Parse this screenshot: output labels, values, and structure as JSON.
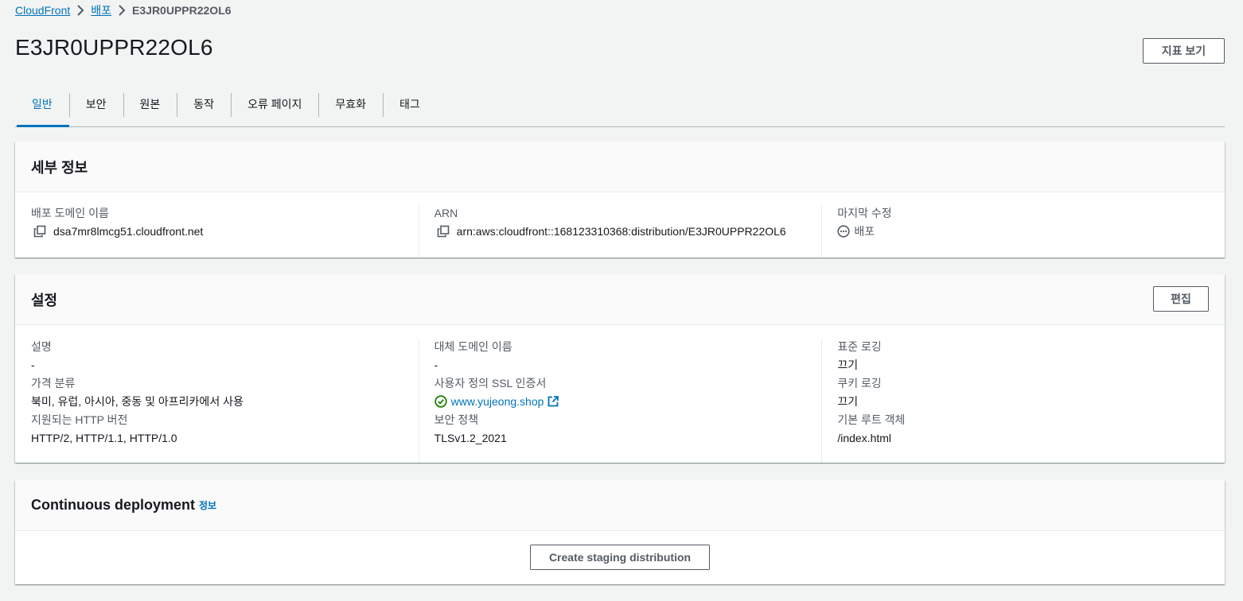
{
  "breadcrumb": {
    "items": [
      "CloudFront",
      "배포"
    ],
    "current": "E3JR0UPPR22OL6"
  },
  "page": {
    "title": "E3JR0UPPR22OL6",
    "metrics_button": "지표 보기"
  },
  "tabs": [
    {
      "label": "일반",
      "active": true
    },
    {
      "label": "보안",
      "active": false
    },
    {
      "label": "원본",
      "active": false
    },
    {
      "label": "동작",
      "active": false
    },
    {
      "label": "오류 페이지",
      "active": false
    },
    {
      "label": "무효화",
      "active": false
    },
    {
      "label": "태그",
      "active": false
    }
  ],
  "details": {
    "title": "세부 정보",
    "domain_label": "배포 도메인 이름",
    "domain_value": "dsa7mr8lmcg51.cloudfront.net",
    "arn_label": "ARN",
    "arn_value": "arn:aws:cloudfront::168123310368:distribution/E3JR0UPPR22OL6",
    "modified_label": "마지막 수정",
    "modified_value": "배포"
  },
  "settings": {
    "title": "설정",
    "edit_button": "편집",
    "description_label": "설명",
    "description_value": "-",
    "price_class_label": "가격 분류",
    "price_class_value": "북미, 유럽, 아시아, 중동 및 아프리카에서 사용",
    "http_label": "지원되는 HTTP 버전",
    "http_value": "HTTP/2, HTTP/1.1, HTTP/1.0",
    "alt_domain_label": "대체 도메인 이름",
    "alt_domain_value": "-",
    "ssl_label": "사용자 정의 SSL 인증서",
    "ssl_value": "www.yujeong.shop",
    "security_policy_label": "보안 정책",
    "security_policy_value": "TLSv1.2_2021",
    "std_logging_label": "표준 로깅",
    "std_logging_value": "끄기",
    "cookie_logging_label": "쿠키 로깅",
    "cookie_logging_value": "끄기",
    "root_object_label": "기본 루트 객체",
    "root_object_value": "/index.html"
  },
  "continuous": {
    "title": "Continuous deployment",
    "info_link": "정보",
    "button": "Create staging distribution"
  },
  "colors": {
    "link": "#0073bb",
    "success": "#1d8102",
    "background": "#f2f3f3"
  }
}
